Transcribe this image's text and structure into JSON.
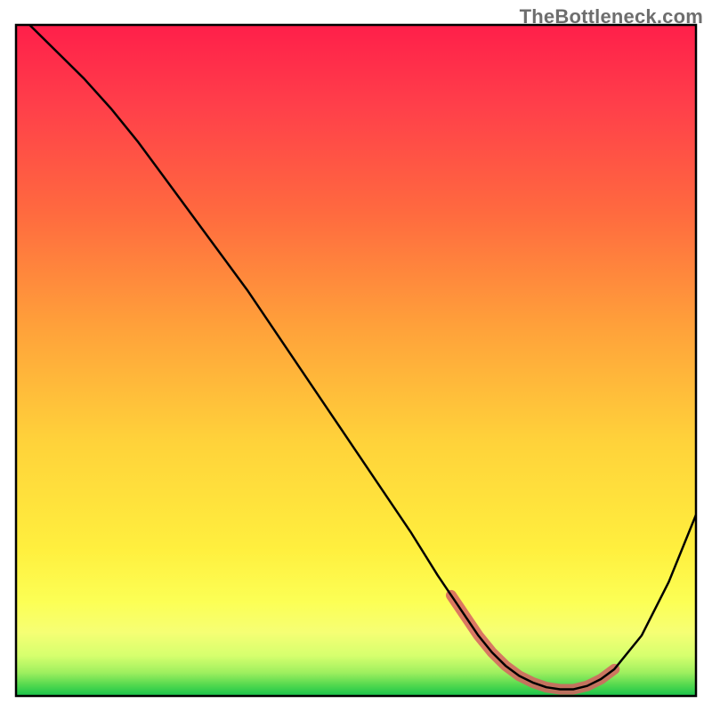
{
  "watermark": "TheBottleneck.com",
  "colors": {
    "border": "#000000",
    "curve": "#000000",
    "overlay_band": "#d66060"
  },
  "gradient_stops": [
    {
      "offset": 0.0,
      "color": "#ff1f4a"
    },
    {
      "offset": 0.12,
      "color": "#ff3f4a"
    },
    {
      "offset": 0.28,
      "color": "#ff6a3f"
    },
    {
      "offset": 0.45,
      "color": "#ffa13a"
    },
    {
      "offset": 0.62,
      "color": "#ffd23a"
    },
    {
      "offset": 0.78,
      "color": "#ffef3e"
    },
    {
      "offset": 0.86,
      "color": "#fcff55"
    },
    {
      "offset": 0.905,
      "color": "#f6ff74"
    },
    {
      "offset": 0.94,
      "color": "#d6ff6e"
    },
    {
      "offset": 0.965,
      "color": "#9fef5f"
    },
    {
      "offset": 0.985,
      "color": "#4ed74e"
    },
    {
      "offset": 1.0,
      "color": "#17c24a"
    }
  ],
  "chart_data": {
    "type": "line",
    "title": "",
    "xlabel": "",
    "ylabel": "",
    "xlim": [
      0,
      100
    ],
    "ylim": [
      0,
      100
    ],
    "grid": false,
    "legend": false,
    "x": [
      2,
      6,
      10,
      14,
      18,
      22,
      26,
      30,
      34,
      38,
      42,
      46,
      50,
      54,
      58,
      62,
      64,
      66,
      68,
      70,
      72,
      74,
      76,
      78,
      80,
      82,
      84,
      86,
      88,
      92,
      96,
      100
    ],
    "values": [
      100,
      96,
      92,
      87.5,
      82.5,
      77,
      71.5,
      66,
      60.5,
      54.5,
      48.5,
      42.5,
      36.5,
      30.5,
      24.5,
      18,
      15,
      12,
      9,
      6.5,
      4.5,
      3,
      2,
      1.3,
      1,
      1,
      1.5,
      2.5,
      4,
      9,
      17,
      27
    ],
    "overlay_segment": {
      "note": "thick semi-transparent band along the valley region",
      "x": [
        64,
        66,
        68,
        70,
        72,
        74,
        76,
        78,
        80,
        82,
        84,
        86,
        88
      ],
      "y": [
        15,
        12,
        9,
        6.5,
        4.5,
        3,
        2,
        1.3,
        1,
        1,
        1.5,
        2.5,
        4
      ]
    }
  }
}
